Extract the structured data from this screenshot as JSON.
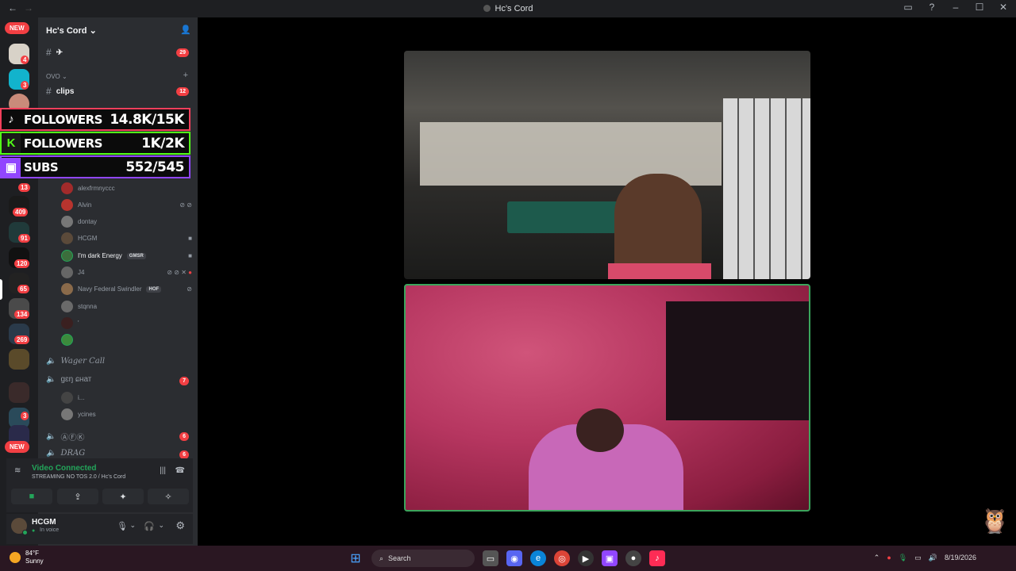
{
  "titlebar": {
    "title": "Hc's Cord",
    "back_icon": "←",
    "fwd_icon": "→"
  },
  "rail": {
    "new_top": "NEW",
    "new_bottom": "NEW",
    "badges": [
      "4",
      "3",
      "13",
      "409",
      "91",
      "120",
      "65",
      "134",
      "269",
      "208",
      "3"
    ]
  },
  "sidebar": {
    "server_name": "Hc's Cord",
    "channels": [
      {
        "name": "✈",
        "badge": "29"
      },
      {
        "name": "clips",
        "badge": "12"
      }
    ],
    "category_ovo": "OVO",
    "voice_users": [
      {
        "name": "alexfrmnyccc",
        "color": "#a22b2b"
      },
      {
        "name": "Alvin",
        "color": "#b8342e"
      },
      {
        "name": "dontay",
        "color": "#777"
      },
      {
        "name": "HCGM",
        "color": "#5b4a3a"
      },
      {
        "name": "I'm dark Energy",
        "color": "#3c6e3c",
        "tag": "GMSR",
        "bright": true
      },
      {
        "name": "J4",
        "color": "#666"
      },
      {
        "name": "Navy Federal Swindler",
        "color": "#8a6a4a",
        "tag": "HOF"
      },
      {
        "name": "stqnna",
        "color": "#6a6a6a"
      },
      {
        "name": "'",
        "color": "#3a2020"
      },
      {
        "name": "",
        "color": "#3c8a3c"
      }
    ],
    "voice_channels": [
      {
        "name": "Wager Call",
        "italic": true
      },
      {
        "name": "ɡɛŋ ɕнат",
        "badge": "7",
        "active": true
      },
      {
        "name": "ⒶⒻⓀ",
        "badge": "6"
      },
      {
        "name": "DRAG",
        "badge": "6",
        "italic": true
      }
    ],
    "sub_users": [
      "i...",
      "ycines"
    ]
  },
  "overlay": {
    "tiktok": {
      "label": "FOLLOWERS",
      "value": "14.8K/15K",
      "color": "#f23f5b"
    },
    "kick": {
      "label": "FOLLOWERS",
      "value": "1K/2K",
      "color": "#53fc18"
    },
    "twitch": {
      "label": "SUBS",
      "value": "552/545",
      "color": "#9146ff"
    }
  },
  "voice_panel": {
    "status": "Video Connected",
    "subtitle": "STREAMING NO TOS 2.0 / Hc's Cord"
  },
  "user_panel": {
    "name": "HCGM",
    "status": "In voice"
  },
  "taskbar": {
    "temp": "84°F",
    "condition": "Sunny",
    "search": "Search",
    "clock": "8/19/2026"
  }
}
